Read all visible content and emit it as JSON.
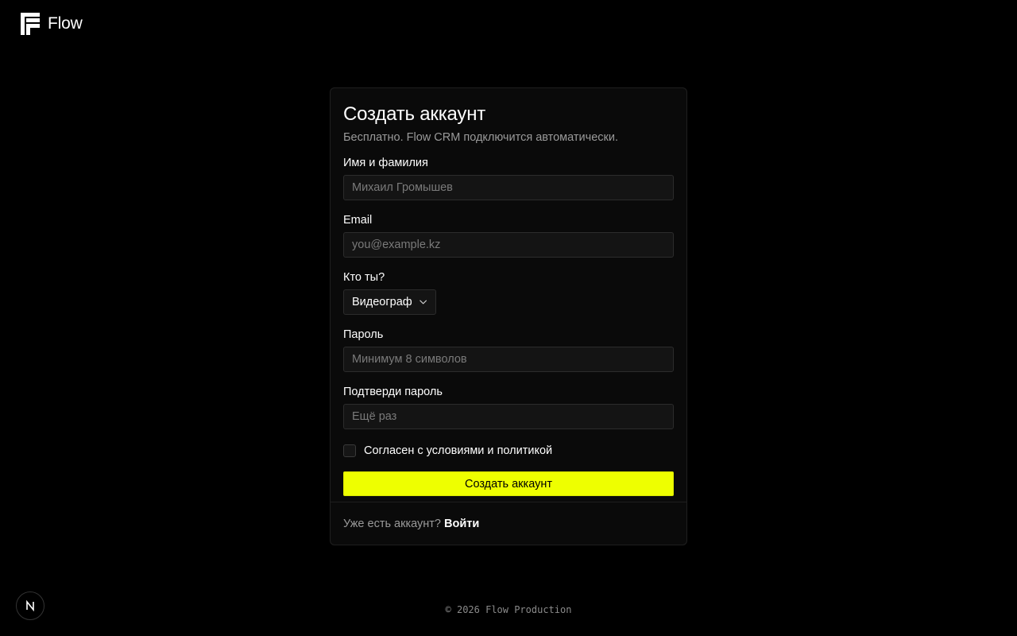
{
  "header": {
    "logo_icon": "flow-logo-icon",
    "logo_text": "Flow"
  },
  "form": {
    "title": "Создать аккаунт",
    "subtitle": "Бесплатно. Flow CRM подключится автоматически.",
    "name": {
      "label": "Имя и фамилия",
      "placeholder": "Михаил Громышев",
      "value": ""
    },
    "email": {
      "label": "Email",
      "placeholder": "you@example.kz",
      "value": ""
    },
    "role": {
      "label": "Кто ты?",
      "selected": "Видеограф",
      "icon": "chevron-down-icon"
    },
    "password": {
      "label": "Пароль",
      "placeholder": "Минимум 8 символов",
      "value": ""
    },
    "confirm": {
      "label": "Подтверди пароль",
      "placeholder": "Ещё раз",
      "value": ""
    },
    "agree": {
      "label": "Согласен с условиями и политикой",
      "checked": false
    },
    "submit_label": "Создать аккаунт"
  },
  "footer": {
    "question": "Уже есть аккаунт?",
    "login_label": "Войти",
    "copyright": "© 2026 Flow Production"
  },
  "dev_badge": {
    "label": "N",
    "icon": "nextjs-icon"
  },
  "colors": {
    "background": "#000000",
    "card": "#0a0a0a",
    "accent": "#eeff00",
    "muted_text": "#9a9a9a"
  }
}
